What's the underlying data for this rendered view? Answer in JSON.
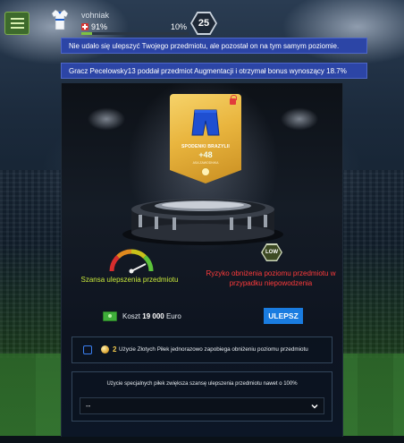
{
  "header": {
    "username": "vohniak",
    "health": "91%",
    "xp_percent": "10%",
    "xp_fraction": 0.1,
    "level": "25"
  },
  "notices": [
    "Nie udało się ulepszyć Twojego przedmiotu, ale pozostał on na tym samym poziomie.",
    "Gracz Pecelowsky13 poddał przedmiot Augmentacji i otrzymał bonus wynoszący 18.7%"
  ],
  "item": {
    "name": "SPODENKI BRAZYLII",
    "bonus": "+48",
    "sub": "ASA ZAWODNIKA"
  },
  "gauge": {
    "label": "Szansa ulepszenia przedmiotu"
  },
  "risk": {
    "badge": "LOW",
    "label": "Ryzyko obniżenia poziomu przedmiotu w przypadku niepowodzenia"
  },
  "cost": {
    "prefix": "Koszt",
    "amount": "19 000",
    "currency": "Euro",
    "button": "ULEPSZ"
  },
  "golden_balls": {
    "count": "2",
    "text": "Użycie Złotych Piłek jednorazowo zapobiega obniżeniu poziomu przedmiotu"
  },
  "special_balls": {
    "text": "Użycie specjalnych piłek zwiększa szansę ulepszenia przedmiotu nawet o 100%",
    "selected": "--"
  },
  "colors": {
    "accent_blue": "#1a7ce0",
    "notice_blue": "#2c45a6",
    "chance_text": "#c8e83a",
    "risk_text": "#ff3b3b",
    "card_gold": "#e9b53e"
  }
}
